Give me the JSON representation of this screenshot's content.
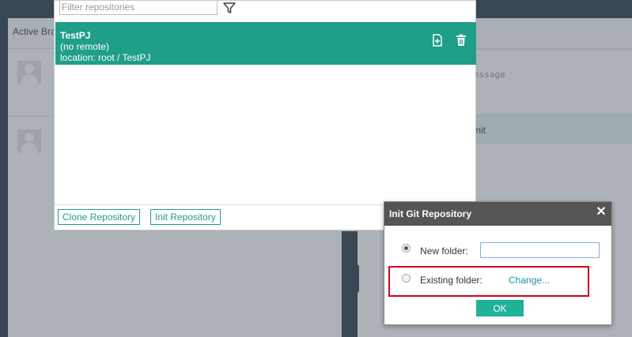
{
  "background": {
    "column_title": "Active Bra",
    "right_column_title": "s",
    "commit_message_placeholder": "essage",
    "commit_button_label": "mit"
  },
  "repo_panel": {
    "filter_placeholder": "Filter repositories",
    "filter_icon": "filter-icon",
    "repositories": [
      {
        "name": "TestPJ",
        "remote": "(no remote)",
        "location": "location: root / TestPJ"
      }
    ],
    "row_actions": [
      "add-file-icon",
      "trash-icon"
    ],
    "clone_button_label": "Clone Repository",
    "init_button_label": "Init Repository"
  },
  "dialog": {
    "title": "Init Git Repository",
    "close_label": "✕",
    "new_folder_label": "New folder:",
    "new_folder_value": "",
    "existing_folder_label": "Existing folder:",
    "change_link_label": "Change...",
    "ok_label": "OK",
    "selected_option": "new_folder"
  },
  "colors": {
    "accent": "#1f9e89",
    "dialog_header": "#555555",
    "highlight": "#d0021b",
    "topbar": "#2e3d49"
  }
}
